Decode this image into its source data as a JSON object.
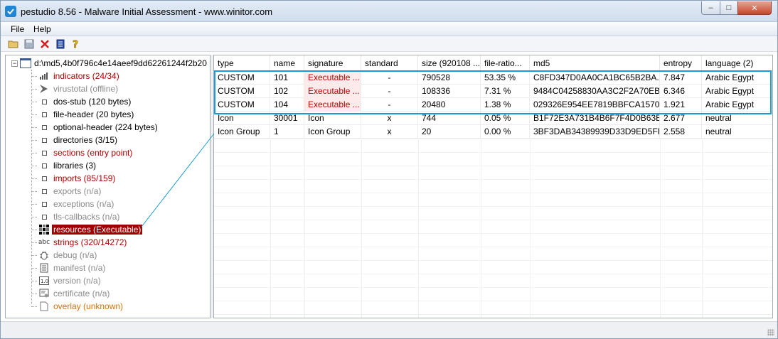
{
  "window": {
    "title": "pestudio 8.56 - Malware Initial Assessment - www.winitor.com",
    "minimize_icon": "minimize-icon",
    "maximize_icon": "maximize-icon",
    "close_icon": "close-icon"
  },
  "menu": {
    "file": "File",
    "help": "Help"
  },
  "toolbar": {
    "icons": [
      "open-folder-icon",
      "save-icon",
      "delete-icon",
      "list-icon",
      "help-icon"
    ]
  },
  "tree": {
    "root_label": "d:\\md5,4b0f796c4e14aeef9dd62261244f2b20",
    "items": [
      {
        "label": "indicators (24/34)",
        "color": "#b00000",
        "icon": "bar-chart-icon"
      },
      {
        "label": "virustotal (offline)",
        "color": "#8a8a8a",
        "icon": "virustotal-icon"
      },
      {
        "label": "dos-stub (120 bytes)",
        "color": "#000000",
        "icon": "square-icon"
      },
      {
        "label": "file-header (20 bytes)",
        "color": "#000000",
        "icon": "square-icon"
      },
      {
        "label": "optional-header (224 bytes)",
        "color": "#000000",
        "icon": "square-icon"
      },
      {
        "label": "directories (3/15)",
        "color": "#000000",
        "icon": "square-icon"
      },
      {
        "label": "sections (entry point)",
        "color": "#b00000",
        "icon": "square-icon"
      },
      {
        "label": "libraries (3)",
        "color": "#000000",
        "icon": "square-icon"
      },
      {
        "label": "imports (85/159)",
        "color": "#b00000",
        "icon": "square-icon"
      },
      {
        "label": "exports (n/a)",
        "color": "#8a8a8a",
        "icon": "square-icon"
      },
      {
        "label": "exceptions (n/a)",
        "color": "#8a8a8a",
        "icon": "square-icon"
      },
      {
        "label": "tls-callbacks (n/a)",
        "color": "#8a8a8a",
        "icon": "square-icon"
      },
      {
        "label": "resources (Executable)",
        "color": "#ffffff",
        "icon": "resources-icon",
        "selected": true
      },
      {
        "label": "strings (320/14272)",
        "color": "#b00000",
        "icon": "strings-abc-icon"
      },
      {
        "label": "debug (n/a)",
        "color": "#8a8a8a",
        "icon": "bug-icon"
      },
      {
        "label": "manifest (n/a)",
        "color": "#8a8a8a",
        "icon": "manifest-icon"
      },
      {
        "label": "version (n/a)",
        "color": "#8a8a8a",
        "icon": "version-icon"
      },
      {
        "label": "certificate (n/a)",
        "color": "#8a8a8a",
        "icon": "certificate-icon"
      },
      {
        "label": "overlay (unknown)",
        "color": "#d9720a",
        "icon": "document-icon"
      }
    ]
  },
  "table": {
    "columns": [
      "type",
      "name",
      "signature",
      "standard",
      "size (920108 ...",
      "file-ratio...",
      "md5",
      "entropy",
      "language (2)"
    ],
    "rows": [
      [
        "CUSTOM",
        "101",
        "Executable ...",
        "-",
        "790528",
        "53.35 %",
        "C8FD347D0AA0CA1BC65B2BA...",
        "7.847",
        "Arabic Egypt"
      ],
      [
        "CUSTOM",
        "102",
        "Executable ...",
        "-",
        "108336",
        "7.31 %",
        "9484C04258830AA3C2F2A70EB...",
        "6.346",
        "Arabic Egypt"
      ],
      [
        "CUSTOM",
        "104",
        "Executable ...",
        "-",
        "20480",
        "1.38 %",
        "029326E954EE7819BBFCA1570...",
        "1.921",
        "Arabic Egypt"
      ],
      [
        "Icon",
        "30001",
        "Icon",
        "x",
        "744",
        "0.05 %",
        "B1F72E3A731B4B6F7F4D0B63B...",
        "2.677",
        "neutral"
      ],
      [
        "Icon Group",
        "1",
        "Icon Group",
        "x",
        "20",
        "0.00 %",
        "3BF3DAB34389939D33D9ED5FE...",
        "2.558",
        "neutral"
      ]
    ],
    "highlight_color": "#1a9bd7",
    "signature_alert_color": "#c00000"
  }
}
